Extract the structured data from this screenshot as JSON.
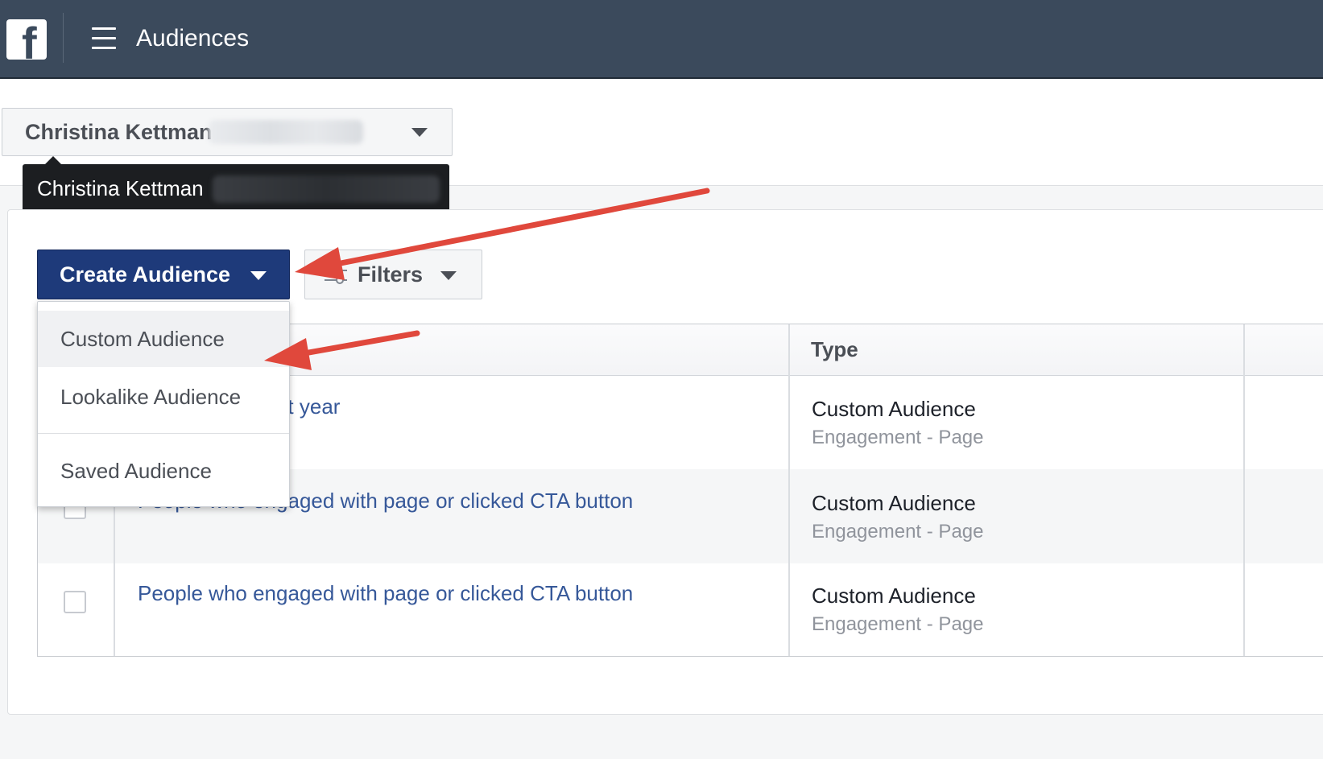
{
  "header": {
    "logo_letter": "f",
    "title": "Audiences"
  },
  "account": {
    "name": "Christina Kettman",
    "tooltip_name": "Christina Kettman"
  },
  "toolbar": {
    "create_label": "Create Audience",
    "filters_label": "Filters"
  },
  "dropdown": {
    "items": [
      {
        "label": "Custom Audience"
      },
      {
        "label": "Lookalike Audience"
      },
      {
        "label": "Saved Audience"
      }
    ]
  },
  "table": {
    "type_header": "Type",
    "rows": [
      {
        "name": "t MS page in last year",
        "type": "Custom Audience",
        "subtype": "Engagement - Page"
      },
      {
        "name": "People who engaged with page or clicked CTA button",
        "type": "Custom Audience",
        "subtype": "Engagement - Page"
      },
      {
        "name": "People who engaged with page or clicked CTA button",
        "type": "Custom Audience",
        "subtype": "Engagement - Page"
      }
    ]
  },
  "colors": {
    "topbar": "#3b4a5c",
    "primary_button": "#1e3a7a",
    "link": "#365899",
    "annotation_arrow": "#e0483c"
  }
}
